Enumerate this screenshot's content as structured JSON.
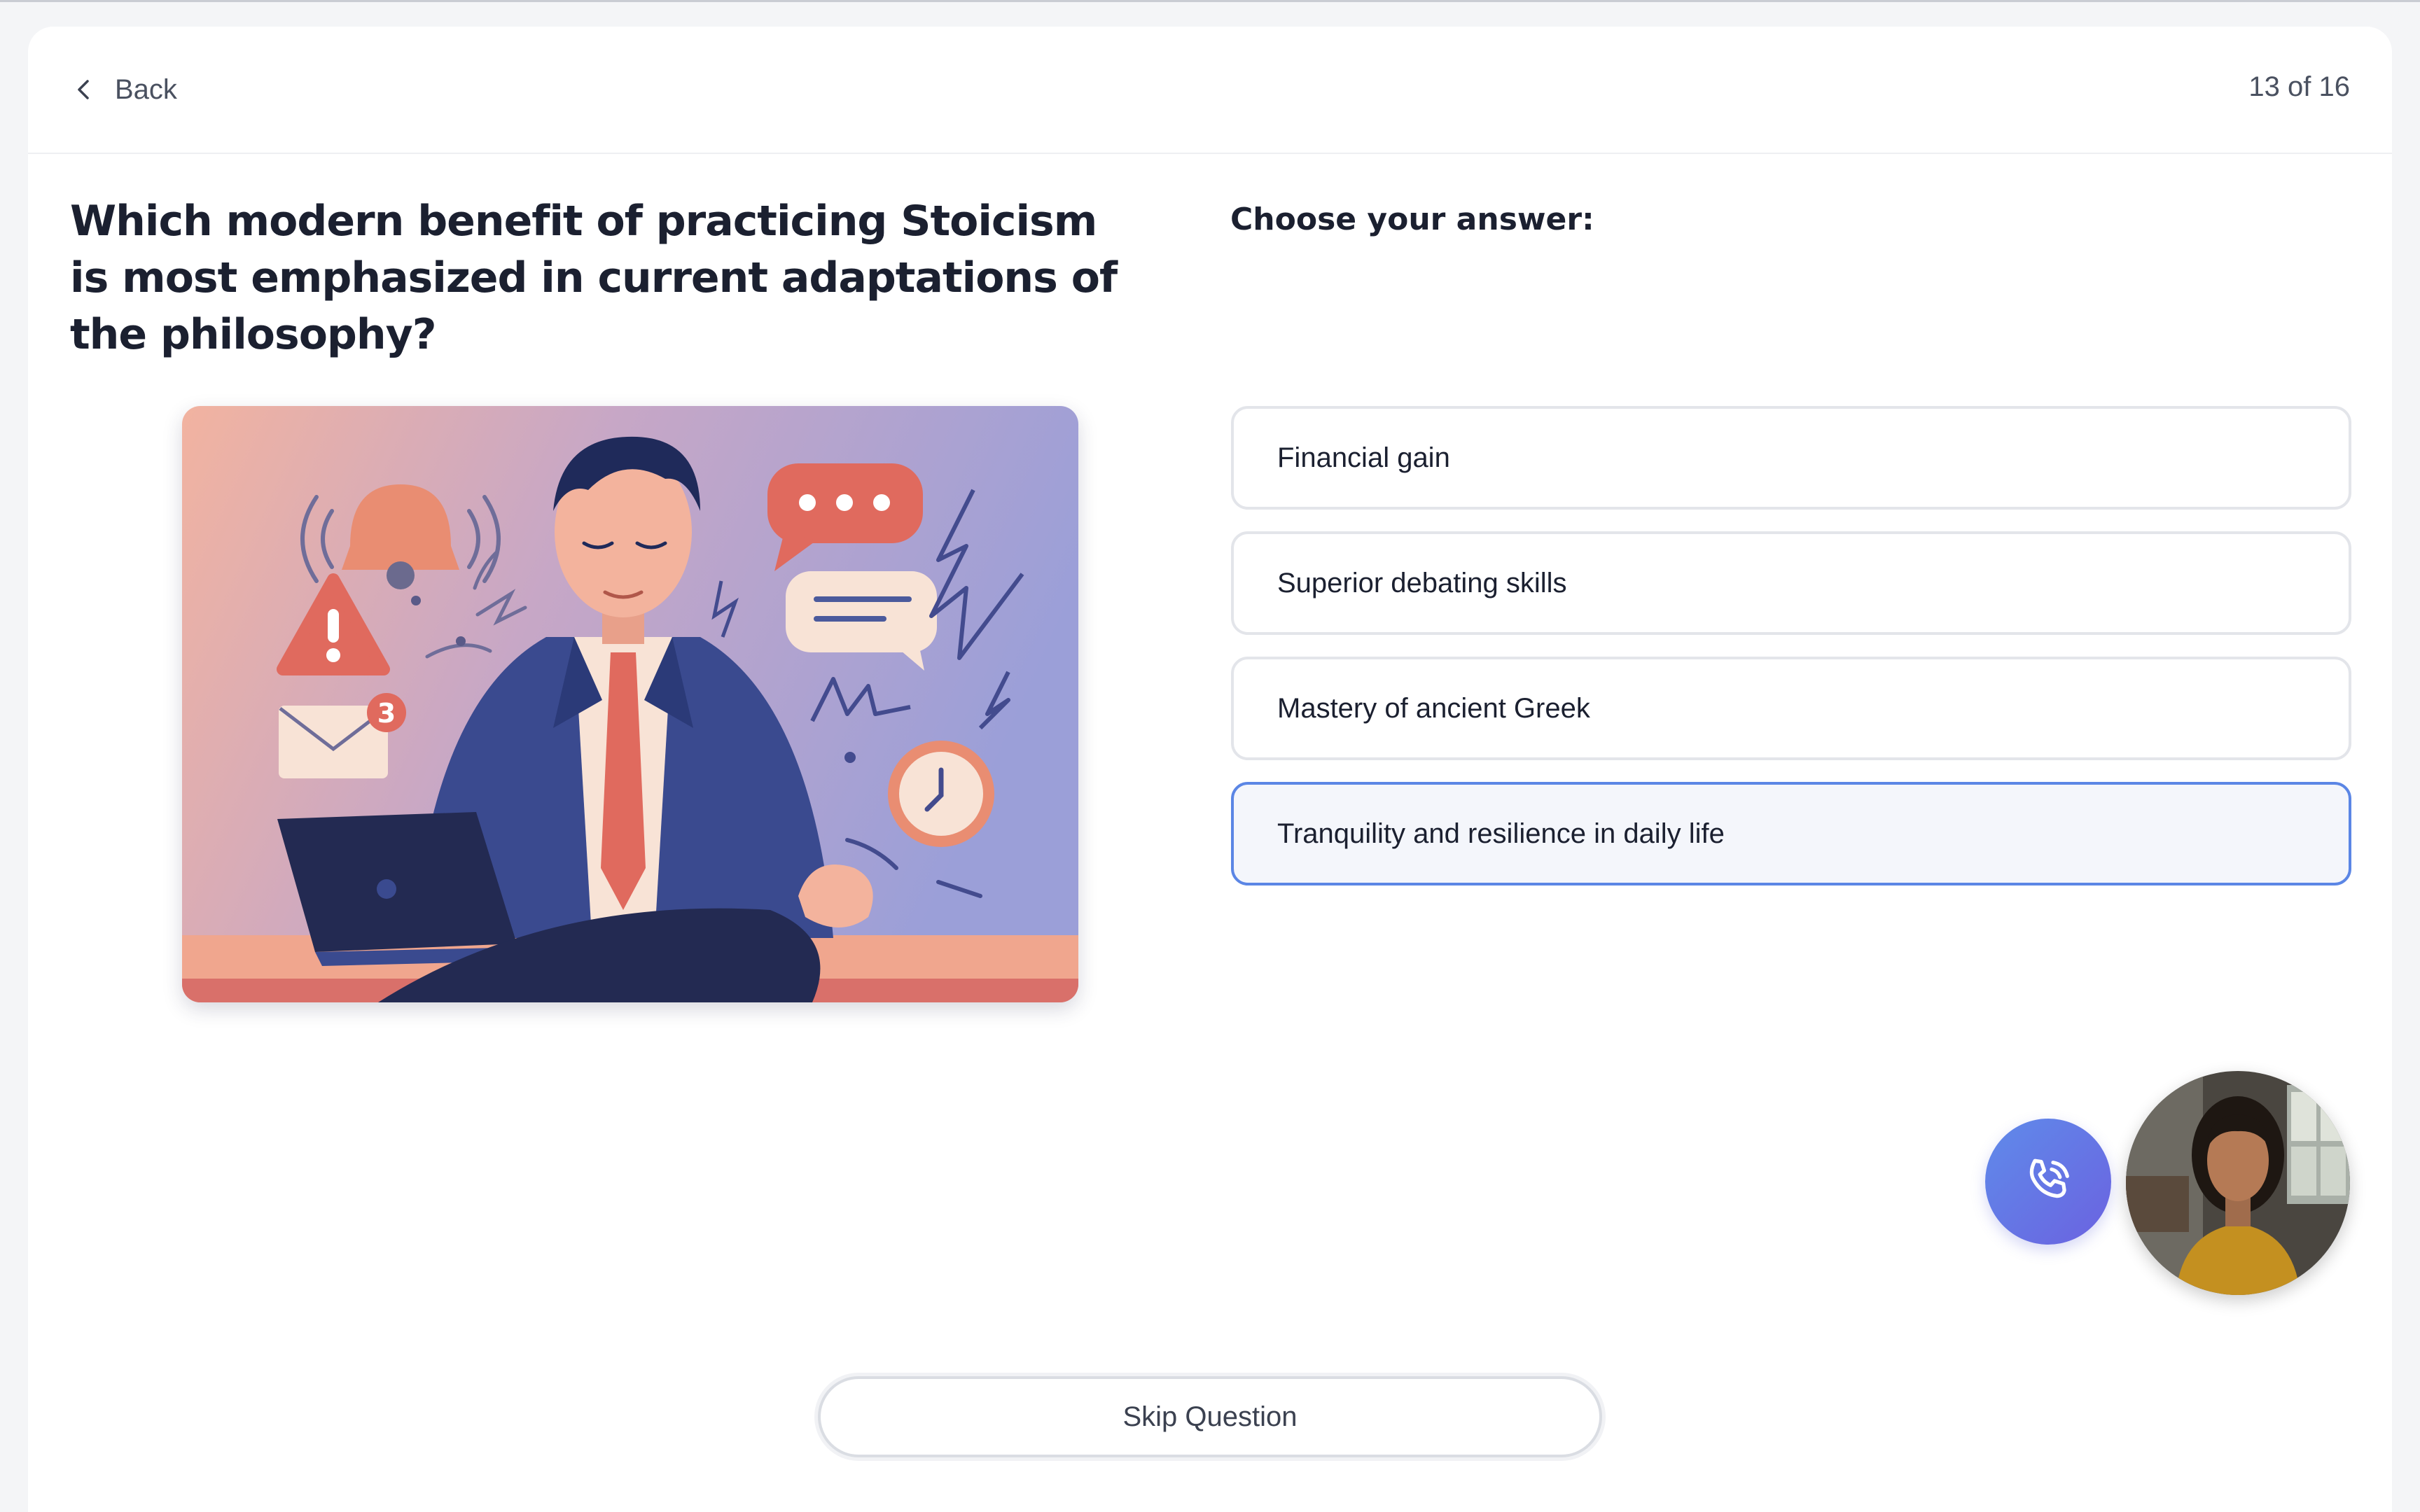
{
  "nav": {
    "back_label": "Back",
    "progress": "13 of 16"
  },
  "question": {
    "text": "Which modern benefit of practicing Stoicism is most emphasized in current adaptations of the philosophy?"
  },
  "answers": {
    "heading": "Choose your answer:",
    "options": [
      {
        "label": "Financial gain",
        "selected": false
      },
      {
        "label": "Superior debating skills",
        "selected": false
      },
      {
        "label": "Mastery of ancient Greek",
        "selected": false
      },
      {
        "label": "Tranquility and resilience in daily life",
        "selected": true
      }
    ]
  },
  "illustration": {
    "notification_count": "3"
  },
  "assistant": {
    "call_icon": "phone-icon"
  },
  "footer": {
    "skip_label": "Skip Question"
  },
  "colors": {
    "accent": "#5b86e5",
    "selected_bg": "#f4f6fb",
    "call_gradient_start": "#5f8bea",
    "call_gradient_end": "#6b62e0"
  }
}
